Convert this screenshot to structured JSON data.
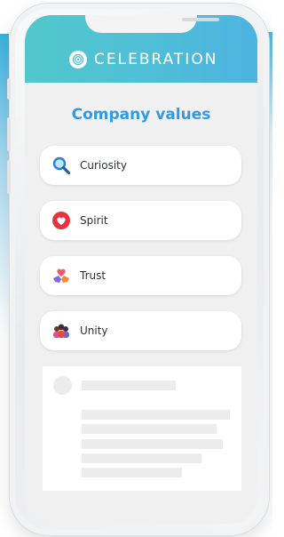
{
  "header": {
    "brand_name": "CELEBRATION",
    "logo_icon": "fingerprint-icon",
    "gradient_colors": [
      "#51c8cb",
      "#4db3e0"
    ]
  },
  "main": {
    "title": "Company values",
    "title_color": "#2f9ae6",
    "values": [
      {
        "label": "Curiosity",
        "icon": "magnifying-glass-icon"
      },
      {
        "label": "Spirit",
        "icon": "heart-icon"
      },
      {
        "label": "Trust",
        "icon": "hands-heart-icon"
      },
      {
        "label": "Unity",
        "icon": "group-people-icon"
      }
    ]
  },
  "placeholder": {
    "state": "loading skeleton"
  }
}
